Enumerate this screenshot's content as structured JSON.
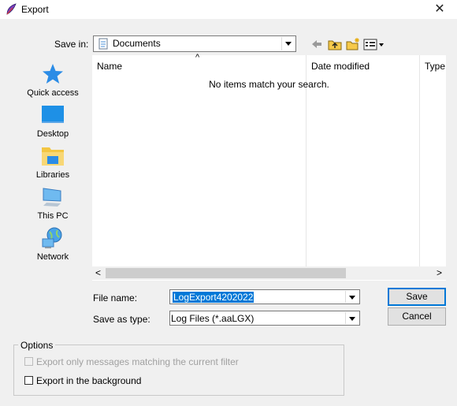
{
  "window": {
    "title": "Export",
    "close_glyph": "✕"
  },
  "save_in": {
    "label": "Save in:",
    "value": "Documents"
  },
  "places": [
    {
      "label": "Quick access",
      "icon": "star-icon"
    },
    {
      "label": "Desktop",
      "icon": "desktop-icon"
    },
    {
      "label": "Libraries",
      "icon": "libraries-icon"
    },
    {
      "label": "This PC",
      "icon": "computer-icon"
    },
    {
      "label": "Network",
      "icon": "network-icon"
    }
  ],
  "file_list": {
    "columns": [
      "Name",
      "Date modified",
      "Type"
    ],
    "empty_message": "No items match your search.",
    "sort_glyph": "^",
    "scroll_left": "<",
    "scroll_right": ">"
  },
  "file_name": {
    "label": "File name:",
    "value": "LogExport4202022"
  },
  "save_as_type": {
    "label": "Save as type:",
    "value": "Log Files (*.aaLGX)"
  },
  "buttons": {
    "save": "Save",
    "cancel": "Cancel"
  },
  "options": {
    "title": "Options",
    "filter_only": {
      "label": "Export only messages matching the current filter",
      "checked": false,
      "enabled": false
    },
    "background": {
      "label": "Export in the background",
      "checked": false,
      "enabled": true
    }
  },
  "colors": {
    "selection": "#0078d7",
    "accent_blue": "#1e90ff"
  }
}
